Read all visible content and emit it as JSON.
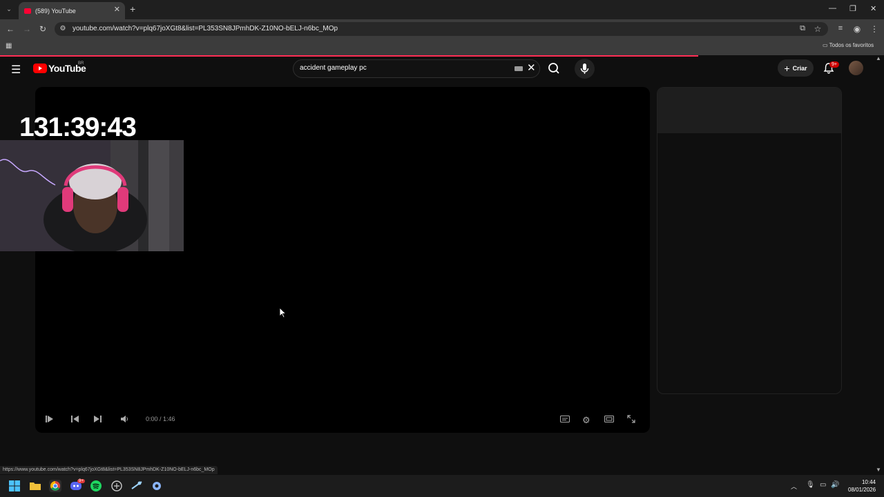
{
  "browser": {
    "tab_title": "(589) YouTube",
    "url": "youtube.com/watch?v=plq67joXGt8&list=PL353SN8JPmhDK-Z10NO-bELJ-n6bc_MOp",
    "bookmarks_folder": "Todos os favoritos",
    "status_link": "https://www.youtube.com/watch?v=plq67joXGt8&list=PL353SN8JPmhDK-Z10NO-bELJ-n6bc_MOp",
    "loading_progress": 0.79
  },
  "youtube": {
    "logo_text": "YouTube",
    "region": "BR",
    "search_query": "accident gameplay pc",
    "create_label": "Criar",
    "notifications_badge": "9+"
  },
  "player": {
    "overlay_timer": "131:39:43",
    "time_display": "0:00 / 1:46"
  },
  "taskbar": {
    "time": "10:44",
    "date": "08/01/2026",
    "discord_badge": "9+"
  },
  "colors": {
    "accent": "#ff0000",
    "loadbar": "#ff2d55",
    "background": "#0f0f0f"
  }
}
